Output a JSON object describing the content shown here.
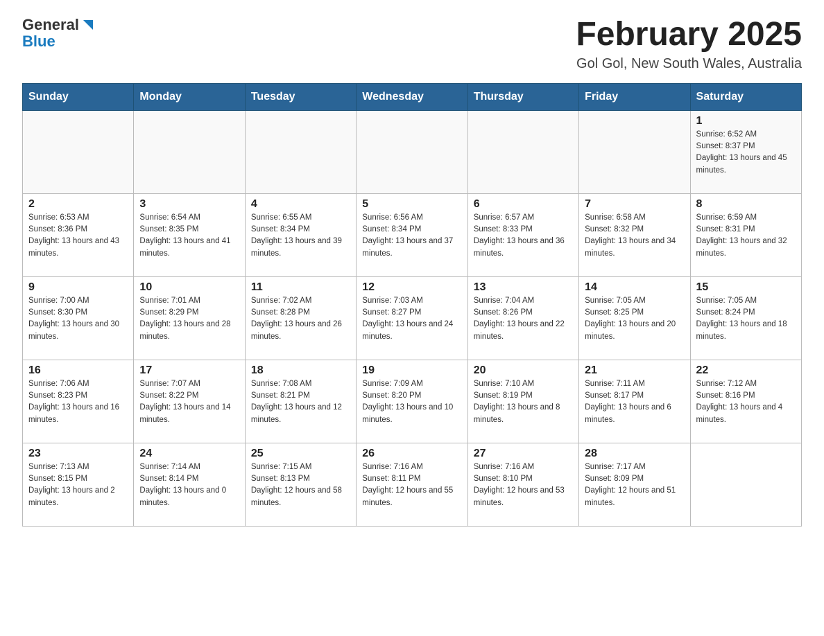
{
  "header": {
    "logo_general": "General",
    "logo_blue": "Blue",
    "title": "February 2025",
    "subtitle": "Gol Gol, New South Wales, Australia"
  },
  "days_of_week": [
    "Sunday",
    "Monday",
    "Tuesday",
    "Wednesday",
    "Thursday",
    "Friday",
    "Saturday"
  ],
  "weeks": [
    [
      {
        "day": "",
        "info": ""
      },
      {
        "day": "",
        "info": ""
      },
      {
        "day": "",
        "info": ""
      },
      {
        "day": "",
        "info": ""
      },
      {
        "day": "",
        "info": ""
      },
      {
        "day": "",
        "info": ""
      },
      {
        "day": "1",
        "info": "Sunrise: 6:52 AM\nSunset: 8:37 PM\nDaylight: 13 hours and 45 minutes."
      }
    ],
    [
      {
        "day": "2",
        "info": "Sunrise: 6:53 AM\nSunset: 8:36 PM\nDaylight: 13 hours and 43 minutes."
      },
      {
        "day": "3",
        "info": "Sunrise: 6:54 AM\nSunset: 8:35 PM\nDaylight: 13 hours and 41 minutes."
      },
      {
        "day": "4",
        "info": "Sunrise: 6:55 AM\nSunset: 8:34 PM\nDaylight: 13 hours and 39 minutes."
      },
      {
        "day": "5",
        "info": "Sunrise: 6:56 AM\nSunset: 8:34 PM\nDaylight: 13 hours and 37 minutes."
      },
      {
        "day": "6",
        "info": "Sunrise: 6:57 AM\nSunset: 8:33 PM\nDaylight: 13 hours and 36 minutes."
      },
      {
        "day": "7",
        "info": "Sunrise: 6:58 AM\nSunset: 8:32 PM\nDaylight: 13 hours and 34 minutes."
      },
      {
        "day": "8",
        "info": "Sunrise: 6:59 AM\nSunset: 8:31 PM\nDaylight: 13 hours and 32 minutes."
      }
    ],
    [
      {
        "day": "9",
        "info": "Sunrise: 7:00 AM\nSunset: 8:30 PM\nDaylight: 13 hours and 30 minutes."
      },
      {
        "day": "10",
        "info": "Sunrise: 7:01 AM\nSunset: 8:29 PM\nDaylight: 13 hours and 28 minutes."
      },
      {
        "day": "11",
        "info": "Sunrise: 7:02 AM\nSunset: 8:28 PM\nDaylight: 13 hours and 26 minutes."
      },
      {
        "day": "12",
        "info": "Sunrise: 7:03 AM\nSunset: 8:27 PM\nDaylight: 13 hours and 24 minutes."
      },
      {
        "day": "13",
        "info": "Sunrise: 7:04 AM\nSunset: 8:26 PM\nDaylight: 13 hours and 22 minutes."
      },
      {
        "day": "14",
        "info": "Sunrise: 7:05 AM\nSunset: 8:25 PM\nDaylight: 13 hours and 20 minutes."
      },
      {
        "day": "15",
        "info": "Sunrise: 7:05 AM\nSunset: 8:24 PM\nDaylight: 13 hours and 18 minutes."
      }
    ],
    [
      {
        "day": "16",
        "info": "Sunrise: 7:06 AM\nSunset: 8:23 PM\nDaylight: 13 hours and 16 minutes."
      },
      {
        "day": "17",
        "info": "Sunrise: 7:07 AM\nSunset: 8:22 PM\nDaylight: 13 hours and 14 minutes."
      },
      {
        "day": "18",
        "info": "Sunrise: 7:08 AM\nSunset: 8:21 PM\nDaylight: 13 hours and 12 minutes."
      },
      {
        "day": "19",
        "info": "Sunrise: 7:09 AM\nSunset: 8:20 PM\nDaylight: 13 hours and 10 minutes."
      },
      {
        "day": "20",
        "info": "Sunrise: 7:10 AM\nSunset: 8:19 PM\nDaylight: 13 hours and 8 minutes."
      },
      {
        "day": "21",
        "info": "Sunrise: 7:11 AM\nSunset: 8:17 PM\nDaylight: 13 hours and 6 minutes."
      },
      {
        "day": "22",
        "info": "Sunrise: 7:12 AM\nSunset: 8:16 PM\nDaylight: 13 hours and 4 minutes."
      }
    ],
    [
      {
        "day": "23",
        "info": "Sunrise: 7:13 AM\nSunset: 8:15 PM\nDaylight: 13 hours and 2 minutes."
      },
      {
        "day": "24",
        "info": "Sunrise: 7:14 AM\nSunset: 8:14 PM\nDaylight: 13 hours and 0 minutes."
      },
      {
        "day": "25",
        "info": "Sunrise: 7:15 AM\nSunset: 8:13 PM\nDaylight: 12 hours and 58 minutes."
      },
      {
        "day": "26",
        "info": "Sunrise: 7:16 AM\nSunset: 8:11 PM\nDaylight: 12 hours and 55 minutes."
      },
      {
        "day": "27",
        "info": "Sunrise: 7:16 AM\nSunset: 8:10 PM\nDaylight: 12 hours and 53 minutes."
      },
      {
        "day": "28",
        "info": "Sunrise: 7:17 AM\nSunset: 8:09 PM\nDaylight: 12 hours and 51 minutes."
      },
      {
        "day": "",
        "info": ""
      }
    ]
  ]
}
